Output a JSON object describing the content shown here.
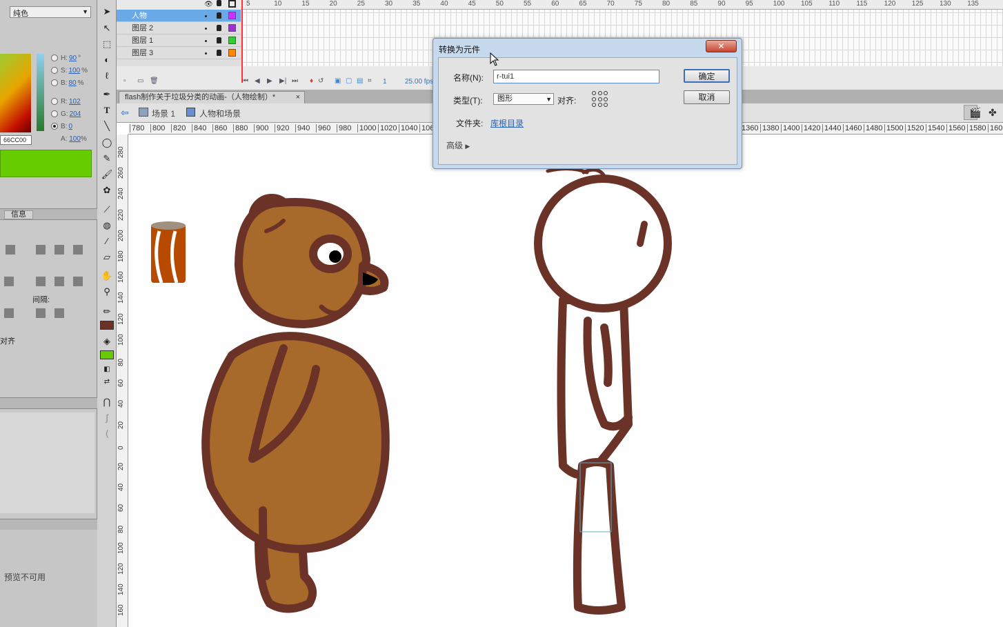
{
  "color_panel": {
    "fill_type": "纯色",
    "h_label": "H:",
    "h_value": "90",
    "h_unit": "°",
    "s_label": "S:",
    "s_value": "100",
    "s_unit": "%",
    "b_label": "B:",
    "b_value": "80",
    "b_unit": "%",
    "r_label": "R:",
    "r_value": "102",
    "g_label": "G:",
    "g_value": "204",
    "bb_label": "B:",
    "bb_value": "0",
    "hex": "66CC00",
    "alpha_label": "A:",
    "alpha_value": "100",
    "alpha_unit": "%",
    "swatch_color": "#66CC00"
  },
  "align_panel": {
    "tab_label": "信息",
    "spacing_label": "间隔:",
    "to_stage_label": "对齐"
  },
  "library_panel": {
    "preview_text": "预览不可用"
  },
  "timeline": {
    "layers": [
      {
        "name": "人物",
        "color": "#cc33ff",
        "selected": true
      },
      {
        "name": "图层 2",
        "color": "#9933cc",
        "selected": false
      },
      {
        "name": "图层 1",
        "color": "#33cc33",
        "selected": false
      },
      {
        "name": "图层 3",
        "color": "#ff8800",
        "selected": false
      }
    ],
    "frame_numbers": [
      "5",
      "10",
      "15",
      "20",
      "25",
      "30",
      "35",
      "40",
      "45",
      "50",
      "55",
      "60",
      "65",
      "70",
      "75",
      "80",
      "85",
      "90",
      "95",
      "100",
      "105",
      "110",
      "115",
      "120",
      "125",
      "130",
      "135"
    ],
    "current_frame": "1",
    "fps": "25.00 fps"
  },
  "document": {
    "tab_title": "flash制作关于垃圾分类的动画-（人物绘制）*",
    "tab_close": "×",
    "scene_label": "场景 1",
    "symbol_label": "人物和场景"
  },
  "rulers": {
    "top": [
      "780",
      "800",
      "820",
      "840",
      "860",
      "880",
      "900",
      "920",
      "940",
      "960",
      "980",
      "1000",
      "1020",
      "1040",
      "1060",
      "1360",
      "1380",
      "1400",
      "1420",
      "1440",
      "1460",
      "1480",
      "1500",
      "1520",
      "1540",
      "1560",
      "1580",
      "160"
    ],
    "left": [
      "280",
      "260",
      "240",
      "220",
      "200",
      "180",
      "160",
      "140",
      "120",
      "100",
      "80",
      "60",
      "40",
      "20",
      "0",
      "20",
      "40",
      "60",
      "80",
      "100",
      "120",
      "140",
      "160"
    ]
  },
  "dialog": {
    "title": "转换为元件",
    "close": "✕",
    "name_label": "名称(N):",
    "name_value": "r-tui1",
    "type_label": "类型(T):",
    "type_value": "图形",
    "align_label": "对齐:",
    "folder_label": "文件夹:",
    "folder_value": "库根目录",
    "advanced_label": "高级",
    "ok_label": "确定",
    "cancel_label": "取消"
  },
  "colors": {
    "outline": "#6b3328",
    "bear_fill": "#a86a2a",
    "can_fill": "#b84a00",
    "accent_blue": "#3b6fb6"
  }
}
